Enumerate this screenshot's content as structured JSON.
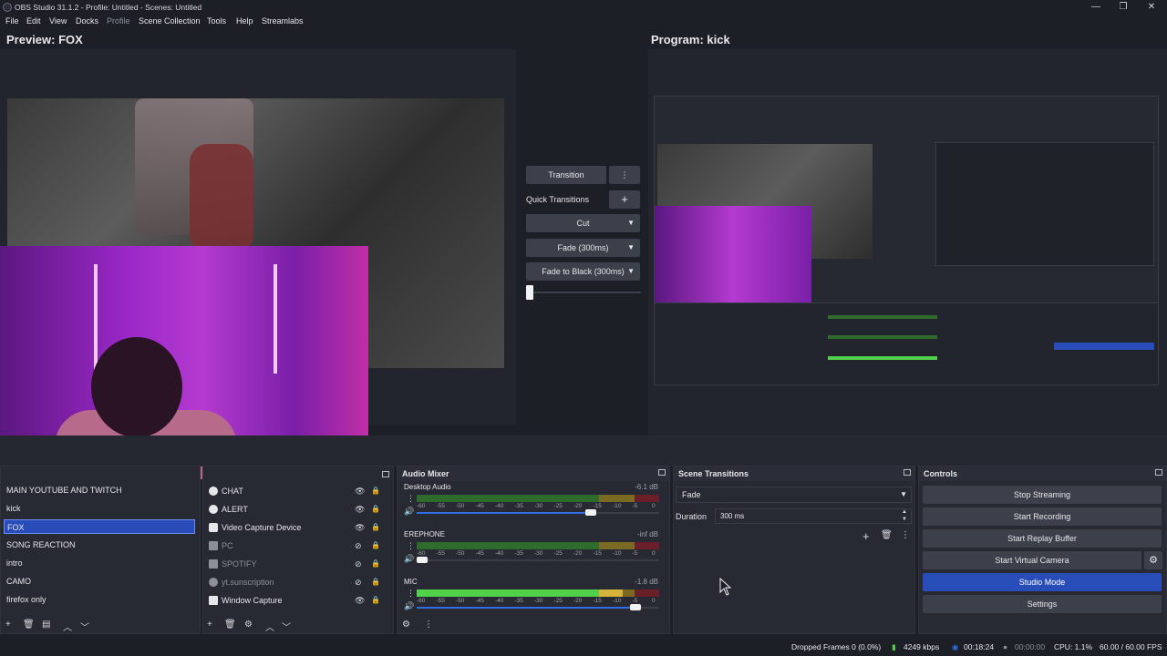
{
  "window": {
    "title": "OBS Studio 31.1.2 - Profile: Untitled - Scenes: Untitled",
    "minimize": "—",
    "maximize": "❐",
    "close": "✕"
  },
  "menu": {
    "items": [
      "File",
      "Edit",
      "View",
      "Docks",
      "Profile",
      "Scene Collection",
      "Tools",
      "Help",
      "Streamlabs"
    ]
  },
  "preview": {
    "label": "Preview: FOX"
  },
  "program": {
    "label": "Program: kick"
  },
  "transitions": {
    "transition_button": "Transition",
    "quick_transitions_label": "Quick Transitions",
    "add": "+",
    "more": "⋮",
    "items": [
      "Cut",
      "Fade (300ms)",
      "Fade to Black (300ms)"
    ]
  },
  "scenes": {
    "items": [
      "MAIN YOUTUBE AND TWITCH",
      "kick",
      "FOX",
      "SONG REACTION",
      "intro",
      "CAMO",
      "firefox only"
    ],
    "selected": "FOX"
  },
  "sources": {
    "items": [
      {
        "label": "CHAT",
        "icon": "browser-icon",
        "visible": true
      },
      {
        "label": "ALERT",
        "icon": "browser-icon",
        "visible": true
      },
      {
        "label": "Video Capture Device",
        "icon": "camera-icon",
        "visible": true
      },
      {
        "label": "PC",
        "icon": "monitor-icon",
        "visible": false
      },
      {
        "label": "SPOTIFY",
        "icon": "window-icon",
        "visible": false
      },
      {
        "label": "yt.sunscription",
        "icon": "browser-icon",
        "visible": false
      },
      {
        "label": "Window Capture",
        "icon": "window-icon",
        "visible": true
      }
    ]
  },
  "audio_mixer": {
    "title": "Audio Mixer",
    "tracks": [
      {
        "name": "Desktop Audio",
        "db": "-6.1 dB",
        "level": 0.0,
        "volume": 0.73
      },
      {
        "name": "EREPHONE",
        "db": "-inf dB",
        "level": 0.0,
        "volume": 0.0
      },
      {
        "name": "MIC",
        "db": "-1.8 dB",
        "level": 0.85,
        "volume": 0.92
      }
    ],
    "scale": [
      "-60",
      "-55",
      "-50",
      "-45",
      "-40",
      "-35",
      "-30",
      "-25",
      "-20",
      "-15",
      "-10",
      "-5",
      "0"
    ]
  },
  "scene_transitions": {
    "title": "Scene Transitions",
    "selected": "Fade",
    "duration_label": "Duration",
    "duration_value": "300 ms"
  },
  "controls": {
    "title": "Controls",
    "stop_streaming": "Stop Streaming",
    "start_recording": "Start Recording",
    "start_replay_buffer": "Start Replay Buffer",
    "start_virtual_camera": "Start Virtual Camera",
    "studio_mode": "Studio Mode",
    "settings": "Settings",
    "gear": "⚙"
  },
  "statusbar": {
    "dropped_frames": "Dropped Frames 0 (0.0%)",
    "bitrate": "4249 kbps",
    "stream_time": "00:18:24",
    "record_time": "00:00:00",
    "cpu": "CPU: 1.1%",
    "fps": "60.00 / 60.00 FPS"
  },
  "colors": {
    "accent": "#284cb8",
    "background": "#1d1f26",
    "panel": "#272a33"
  }
}
